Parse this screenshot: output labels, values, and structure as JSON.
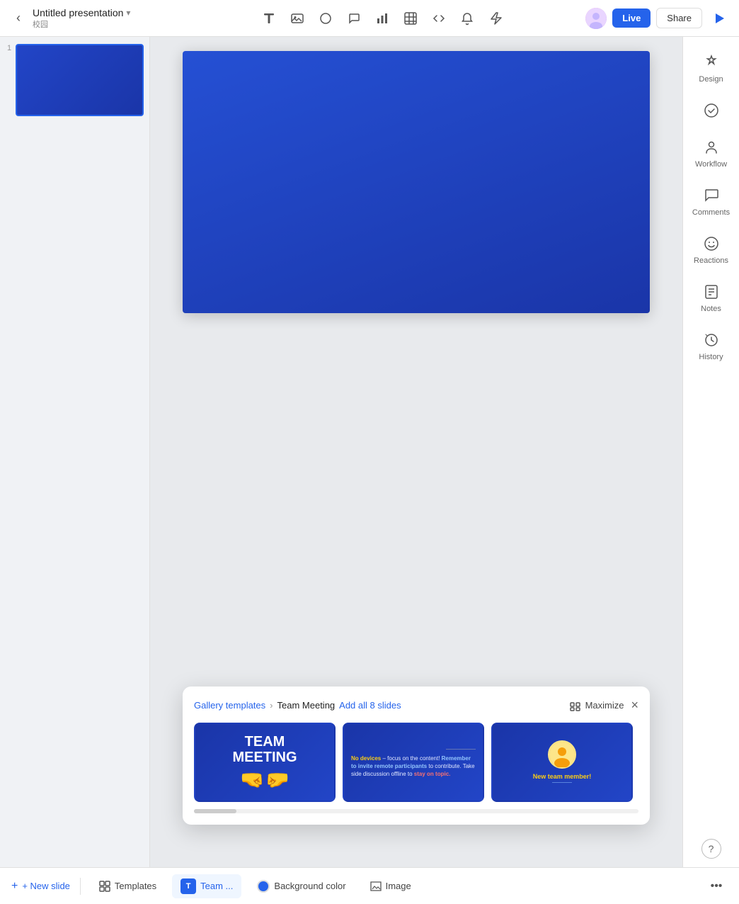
{
  "topbar": {
    "back_icon": "‹",
    "title": "Untitled presentation",
    "title_caret": "▾",
    "subtitle": "校园",
    "tools": [
      {
        "name": "text-tool",
        "icon": "⊞",
        "label": "Text"
      },
      {
        "name": "image-tool",
        "icon": "🖼",
        "label": "Image"
      },
      {
        "name": "shape-tool",
        "icon": "◎",
        "label": "Shape"
      },
      {
        "name": "comment-tool",
        "icon": "💬",
        "label": "Comment"
      },
      {
        "name": "chart-tool",
        "icon": "📊",
        "label": "Chart"
      },
      {
        "name": "table-tool",
        "icon": "⊞",
        "label": "Table"
      },
      {
        "name": "embed-tool",
        "icon": "⟨⟩",
        "label": "Embed"
      },
      {
        "name": "notification-bell",
        "icon": "🔔",
        "label": "Bell"
      },
      {
        "name": "lightning-tool",
        "icon": "⚡",
        "label": "Lightning"
      }
    ],
    "live_label": "Live",
    "share_label": "Share",
    "play_icon": "▶"
  },
  "slides": [
    {
      "number": "1",
      "bg": "linear-gradient(135deg, #2245c7, #1a35a8)"
    }
  ],
  "canvas": {
    "slide_bg": "linear-gradient(160deg, #2550d4 0%, #1a35a8 100%)"
  },
  "right_sidebar": {
    "items": [
      {
        "name": "design",
        "icon": "✦",
        "label": "Design"
      },
      {
        "name": "workflow",
        "icon": "✓",
        "label": ""
      },
      {
        "name": "user-workflow",
        "icon": "👤",
        "label": "Workflow"
      },
      {
        "name": "comments",
        "icon": "💬",
        "label": "Comments"
      },
      {
        "name": "reactions",
        "icon": "😊",
        "label": "Reactions"
      },
      {
        "name": "notes",
        "icon": "📝",
        "label": "Notes"
      },
      {
        "name": "history",
        "icon": "⏱",
        "label": "History"
      }
    ]
  },
  "bottom_bar": {
    "templates_label": "Templates",
    "team_label": "Team ...",
    "bg_color_label": "Background color",
    "image_label": "Image",
    "more_icon": "•••"
  },
  "template_popup": {
    "breadcrumb_link": "Gallery templates",
    "breadcrumb_sep": "›",
    "breadcrumb_current": "Team Meeting",
    "add_all_label": "Add all 8 slides",
    "maximize_label": "Maximize",
    "close_icon": "×",
    "templates": [
      {
        "name": "team-meeting-main",
        "title_line1": "Team",
        "title_line2": "Meeting",
        "has_fist": true
      },
      {
        "name": "team-meeting-rules",
        "text_parts": [
          {
            "text": "No devices",
            "style": "highlight-yellow"
          },
          {
            "text": " – focus on the content! ",
            "style": "normal"
          },
          {
            "text": "Remember to invite remote participants",
            "style": "highlight-blue"
          },
          {
            "text": " to contribute. Take side discussion offline to ",
            "style": "normal"
          },
          {
            "text": "stay on topic.",
            "style": "highlight-red"
          }
        ]
      },
      {
        "name": "new-team-member",
        "label": "New team member!"
      }
    ],
    "scroll_indicator": true
  },
  "new_slide": {
    "label": "+ New slide"
  }
}
